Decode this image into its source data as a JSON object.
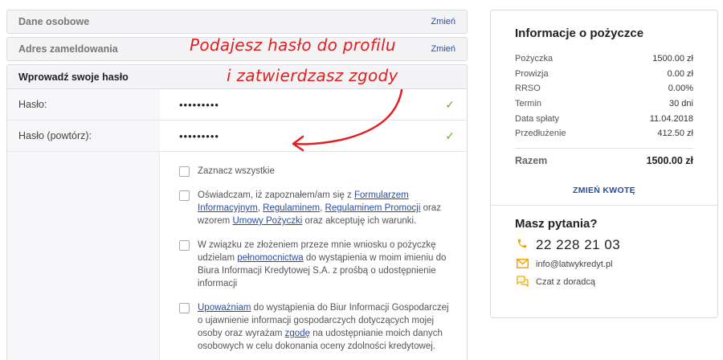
{
  "sections": {
    "personal": {
      "title": "Dane osobowe",
      "change": "Zmień"
    },
    "address": {
      "title": "Adres zameldowania",
      "change": "Zmień"
    }
  },
  "password_form": {
    "title": "Wprowadź swoje hasło",
    "password_label": "Hasło:",
    "password_value": "•••••••••",
    "password_repeat_label": "Hasło (powtórz):",
    "password_repeat_value": "•••••••••",
    "check_icon": "check-icon"
  },
  "consents": {
    "select_all": "Zaznacz wszystkie",
    "c1": {
      "t1": "Oświadczam, iż zapoznałem/am się z ",
      "l1": "Formularzem Informacyjnym",
      "t2": ", ",
      "l2": "Regulaminem",
      "t3": ", ",
      "l3": "Regulaminem Promocji",
      "t4": " oraz wzorem ",
      "l4": "Umowy Pożyczki",
      "t5": " oraz akceptuję ich warunki."
    },
    "c2": {
      "t1": "W związku ze złożeniem przeze mnie wniosku o pożyczkę udzielam ",
      "l1": "pełnomocnictwa",
      "t2": " do wystąpienia w moim imieniu do Biura Informacji Kredytowej S.A. z prośbą o udostępnienie informacji"
    },
    "c3": {
      "l1": "Upoważniam",
      "t1": " do wystąpienia do Biur Informacji Gospodarczej o ujawnienie informacji gospodarczych dotyczących mojej osoby oraz wyrażam ",
      "l2": "zgodę",
      "t2": " na udostępnianie moich danych osobowych w celu dokonania oceny zdolności kredytowej."
    }
  },
  "annotation": {
    "line1": "Podajesz hasło do profilu",
    "line2": "i zatwierdzasz zgody",
    "color": "#e02020"
  },
  "loan_info": {
    "title": "Informacje o pożyczce",
    "rows": [
      {
        "label": "Pożyczka",
        "value": "1500.00 zł"
      },
      {
        "label": "Prowizja",
        "value": "0.00 zł"
      },
      {
        "label": "RRSO",
        "value": "0.00%"
      },
      {
        "label": "Termin",
        "value": "30 dni"
      },
      {
        "label": "Data spłaty",
        "value": "11.04.2018"
      },
      {
        "label": "Przedłużenie",
        "value": "412.50 zł"
      }
    ],
    "total_label": "Razem",
    "total_value": "1500.00 zł",
    "change_amount": "ZMIEŃ KWOTĘ"
  },
  "contact": {
    "title": "Masz pytania?",
    "phone": "22 228 21 03",
    "email": "info@latwykredyt.pl",
    "chat": "Czat z doradcą",
    "accent": "#f2a800"
  },
  "colors": {
    "link": "#2b4c9e",
    "check": "#5fb130"
  }
}
